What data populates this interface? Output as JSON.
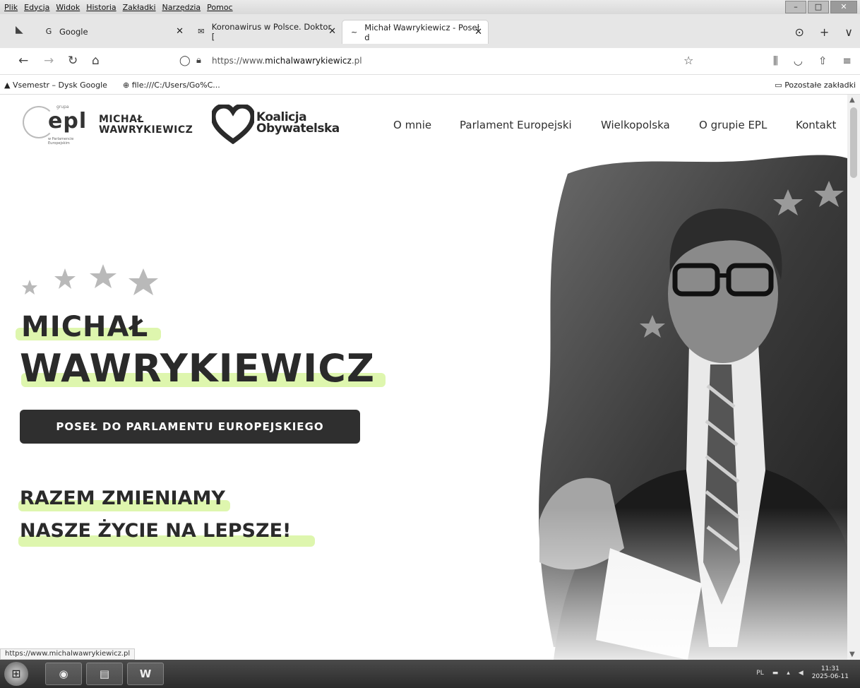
{
  "menubar": {
    "items": [
      "Plik",
      "Edycja",
      "Widok",
      "Historia",
      "Zakładki",
      "Narzędzia",
      "Pomoc"
    ]
  },
  "tabs": [
    {
      "label": "Google",
      "favicon": "G"
    },
    {
      "label": "Koronawirus w Polsce. Doktor [",
      "favicon": "✉"
    },
    {
      "label": "Michał Wawrykiewicz - Poseł d",
      "favicon": "~"
    }
  ],
  "addressbar": {
    "prefix": "https://www.",
    "domain": "michalwawrykiewicz",
    "suffix": ".pl"
  },
  "bookmarks": [
    {
      "label": "Vsemestr – Dysk Google",
      "icon": "drive-icon"
    },
    {
      "label": "file:///C:/Users/Go%C...",
      "icon": "globe-icon"
    }
  ],
  "bookmarks_other": "Pozostałe zakładki",
  "site": {
    "logo_epl": "epl",
    "logo_epl_super": "grupa",
    "logo_epl_sub": "w Parlamencie Europejskim",
    "name_line1": "MICHAŁ",
    "name_line2": "WAWRYKIEWICZ",
    "ko_line1": "Koalicja",
    "ko_line2": "Obywatelska",
    "nav": [
      "O mnie",
      "Parlament Europejski",
      "Wielkopolska",
      "O grupie EPL",
      "Kontakt"
    ]
  },
  "hero": {
    "first_name": "MICHAŁ",
    "last_name": "WAWRYKIEWICZ",
    "badge": "POSEŁ DO PARLAMENTU EUROPEJSKIEGO",
    "slogan_line1": "RAZEM ZMIENIAMY",
    "slogan_line2": "NASZE ŻYCIE NA LEPSZE!",
    "accent_color": "#d8f5a0"
  },
  "status_url": "https://www.michalwawrykiewicz.pl",
  "taskbar": {
    "lang": "PL",
    "time": "11:31",
    "date": "2025-06-11"
  }
}
